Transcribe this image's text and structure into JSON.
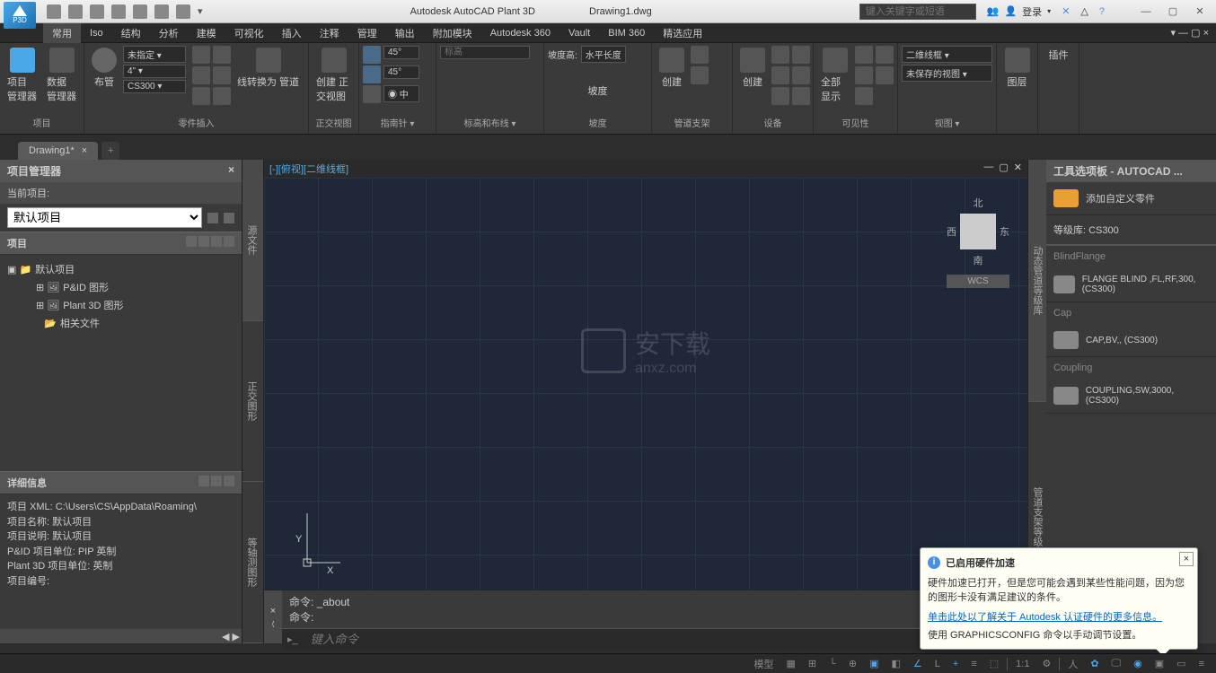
{
  "app": {
    "title": "Autodesk AutoCAD Plant 3D",
    "document": "Drawing1.dwg",
    "search_placeholder": "键入关键字或短语",
    "login": "登录",
    "p3d": "P3D"
  },
  "menu": [
    "常用",
    "Iso",
    "结构",
    "分析",
    "建模",
    "可视化",
    "插入",
    "注释",
    "管理",
    "输出",
    "附加模块",
    "Autodesk 360",
    "Vault",
    "BIM 360",
    "精选应用"
  ],
  "ribbon": {
    "panels": [
      {
        "label": "项目",
        "buttons": [
          "项目\n管理器",
          "数据\n管理器"
        ]
      },
      {
        "label": "零件插入",
        "buttons": [
          "布管"
        ],
        "dropdowns": [
          "未指定",
          "4\"",
          "CS300"
        ],
        "extra": "线转换为\n管道"
      },
      {
        "label": "正交视图",
        "buttons": [
          "创建\n正交视图"
        ]
      },
      {
        "label": "指南针 ▾",
        "dropdowns": [
          "45°",
          "45°",
          "◉ 中"
        ]
      },
      {
        "label": "标高和布线 ▾",
        "input": "标高"
      },
      {
        "label": "坡度",
        "labels": [
          "坡度高:",
          "水平长度"
        ],
        "btn": "坡度"
      },
      {
        "label": "管道支架",
        "buttons": [
          "创建",
          "创建"
        ]
      },
      {
        "label": "设备"
      },
      {
        "label": "可见性",
        "buttons": [
          "全部\n显示"
        ]
      },
      {
        "label": "视图 ▾",
        "dropdowns": [
          "二维线框",
          "未保存的视图"
        ],
        "btn": "图层"
      },
      {
        "label": "",
        "btn": "插件"
      }
    ]
  },
  "file_tab": "Drawing1*",
  "project_manager": {
    "title": "项目管理器",
    "current_label": "当前项目:",
    "current_value": "默认项目",
    "section": "项目",
    "tree": {
      "root": "默认项目",
      "children": [
        "P&ID 图形",
        "Plant 3D 图形",
        "相关文件"
      ]
    },
    "details_title": "详细信息",
    "details": [
      "项目 XML:  C:\\Users\\CS\\AppData\\Roaming\\",
      "项目名称:  默认项目",
      "项目说明:  默认项目",
      "P&ID 项目单位:  PIP 英制",
      "Plant 3D 项目单位:  英制",
      "项目编号:"
    ]
  },
  "side_tabs": [
    "源文件",
    "正交图形",
    "等轴测图形"
  ],
  "canvas": {
    "view_label_1": "[-][俯视]",
    "view_label_2": "[二维线框]",
    "compass": {
      "n": "北",
      "s": "南",
      "e": "东",
      "w": "西"
    },
    "wcs": "WCS",
    "axis_x": "X",
    "axis_y": "Y",
    "watermark": "安下载\nanxz.com"
  },
  "command": {
    "line1": "命令: _about",
    "line2": "命令:",
    "placeholder": "键入命令"
  },
  "tool_palette": {
    "title": "工具选项板 - AUTOCAD ...",
    "add_custom": "添加自定义零件",
    "spec_lib": "等级库: CS300",
    "side_tabs": [
      "动态管道等级库",
      "管道支架等级库"
    ],
    "categories": [
      {
        "name": "BlindFlange",
        "items": [
          "FLANGE BLIND ,FL,RF,300, (CS300)"
        ]
      },
      {
        "name": "Cap",
        "items": [
          "CAP,BV,, (CS300)"
        ]
      },
      {
        "name": "Coupling",
        "items": [
          "COUPLING,SW,3000, (CS300)"
        ]
      }
    ]
  },
  "popup": {
    "title": "已启用硬件加速",
    "body1": "硬件加速已打开，但是您可能会遇到某些性能问题，因为您的图形卡没有满足建议的条件。",
    "link": "单击此处以了解关于 Autodesk 认证硬件的更多信息。",
    "body2": "使用 GRAPHICSCONFIG 命令以手动调节设置。"
  },
  "status": {
    "model": "模型",
    "scale": "1:1"
  }
}
